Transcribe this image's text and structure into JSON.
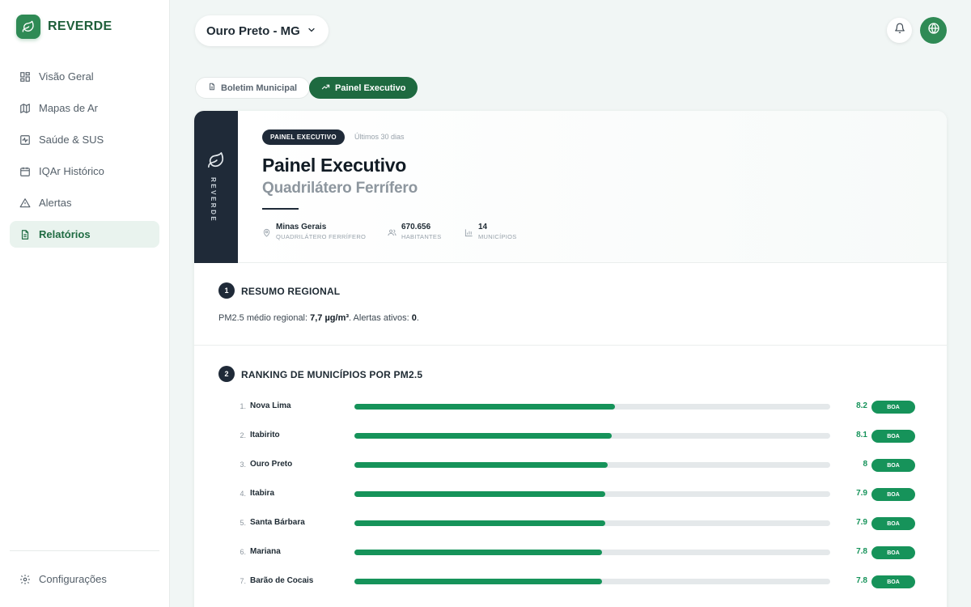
{
  "brand": {
    "name": "REVERDE"
  },
  "sidebar": {
    "items": [
      {
        "label": "Visão Geral",
        "icon": "grid-icon",
        "active": false
      },
      {
        "label": "Mapas de Ar",
        "icon": "map-icon",
        "active": false
      },
      {
        "label": "Saúde & SUS",
        "icon": "health-icon",
        "active": false
      },
      {
        "label": "IQAr Histórico",
        "icon": "calendar-icon",
        "active": false
      },
      {
        "label": "Alertas",
        "icon": "alert-triangle-icon",
        "active": false
      },
      {
        "label": "Relatórios",
        "icon": "file-text-icon",
        "active": true
      }
    ],
    "settings_label": "Configurações"
  },
  "header": {
    "city": "Ouro Preto - MG"
  },
  "tabs": [
    {
      "label": "Boletim Municipal",
      "icon": "document-icon",
      "active": false
    },
    {
      "label": "Painel Executivo",
      "icon": "trending-up-icon",
      "active": true
    }
  ],
  "report": {
    "side_label": "REVERDE",
    "chip": "PAINEL EXECUTIVO",
    "period": "Últimos 30 dias",
    "title": "Painel Executivo",
    "subtitle": "Quadrilátero Ferrífero",
    "stats": [
      {
        "value": "Minas Gerais",
        "label": "QUADRILÁTERO FERRÍFERO",
        "icon": "map-pin-icon"
      },
      {
        "value": "670.656",
        "label": "HABITANTES",
        "icon": "users-icon"
      },
      {
        "value": "14",
        "label": "MUNICÍPIOS",
        "icon": "bar-chart-icon"
      }
    ]
  },
  "section1": {
    "number": "1",
    "title": "RESUMO REGIONAL",
    "summary_prefix": "PM2.5 médio regional: ",
    "summary_value": "7,7 µg/m³",
    "summary_mid": ". Alertas ativos: ",
    "summary_alerts": "0",
    "summary_end": "."
  },
  "section2": {
    "number": "2",
    "title": "RANKING DE MUNICÍPIOS POR PM2.5",
    "bar_max": 15,
    "rows": [
      {
        "rank": "1.",
        "name": "Nova Lima",
        "value": "8.2",
        "quality": "BOA"
      },
      {
        "rank": "2.",
        "name": "Itabirito",
        "value": "8.1",
        "quality": "BOA"
      },
      {
        "rank": "3.",
        "name": "Ouro Preto",
        "value": "8",
        "quality": "BOA"
      },
      {
        "rank": "4.",
        "name": "Itabira",
        "value": "7.9",
        "quality": "BOA"
      },
      {
        "rank": "5.",
        "name": "Santa Bárbara",
        "value": "7.9",
        "quality": "BOA"
      },
      {
        "rank": "6.",
        "name": "Mariana",
        "value": "7.8",
        "quality": "BOA"
      },
      {
        "rank": "7.",
        "name": "Barão de Cocais",
        "value": "7.8",
        "quality": "BOA"
      }
    ]
  },
  "colors": {
    "accent": "#2f8a55",
    "good": "#16935a",
    "dark": "#1f2a38"
  }
}
